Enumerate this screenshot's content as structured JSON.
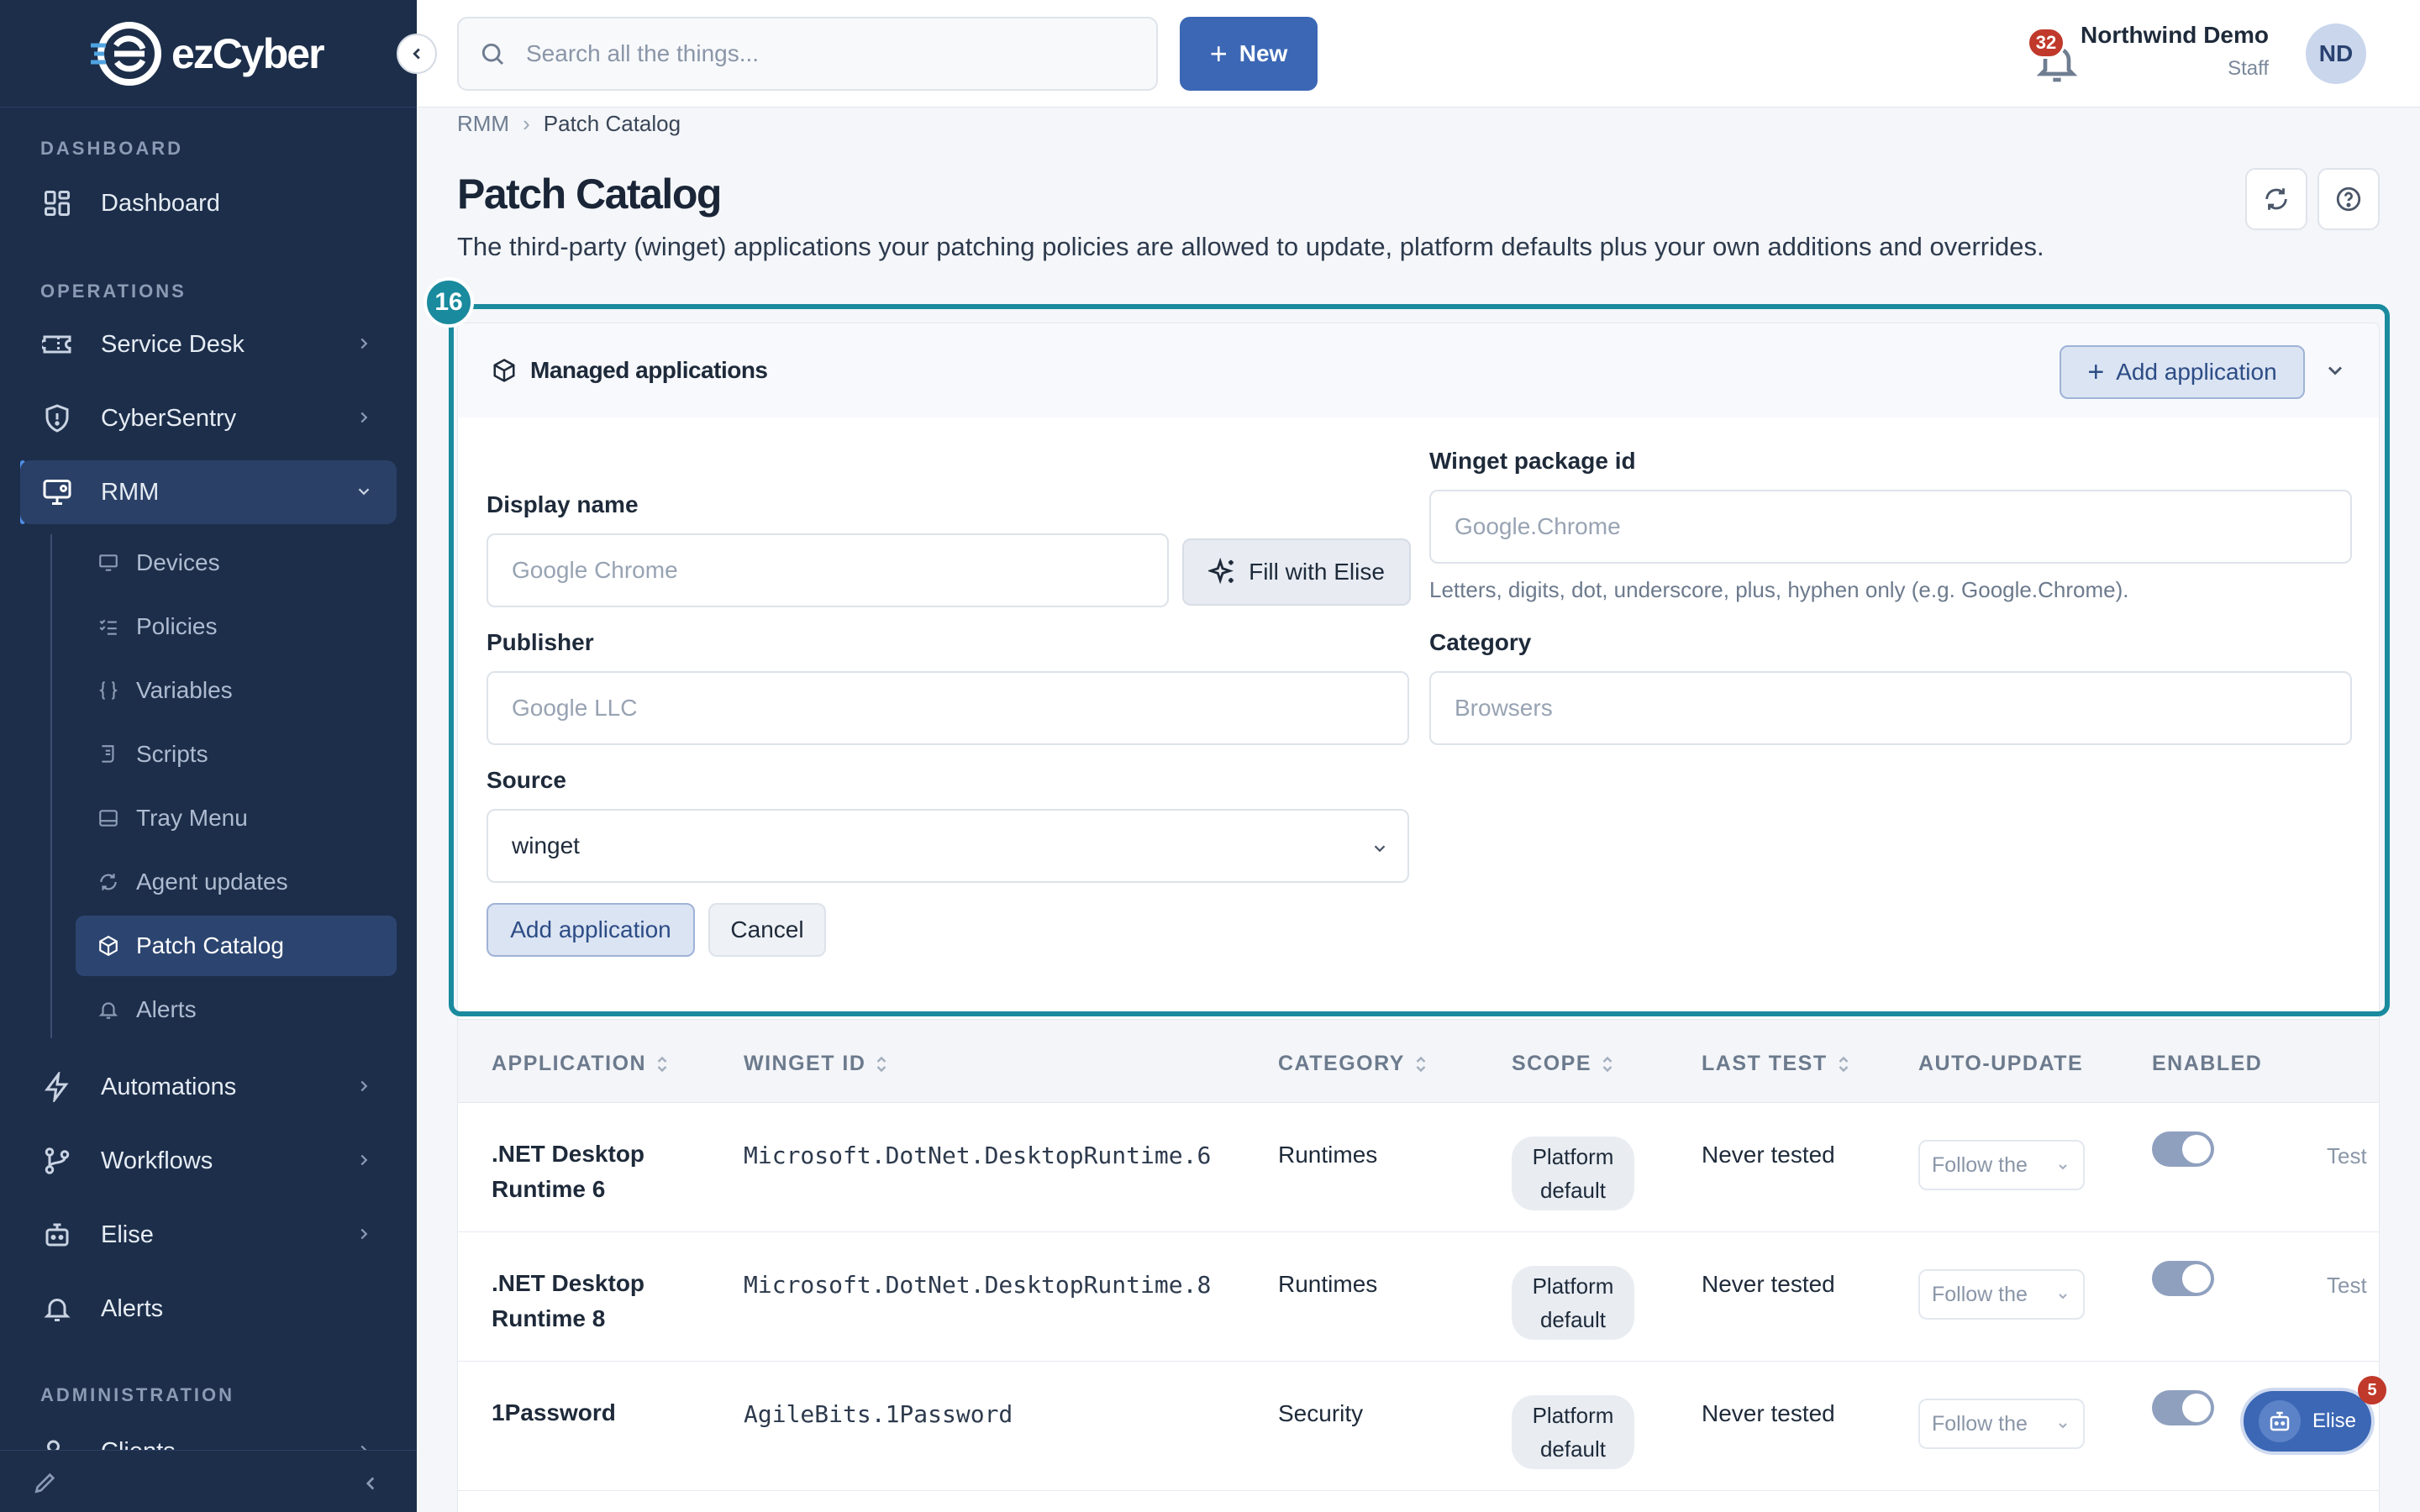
{
  "brand": {
    "logo_text": "ezCyber"
  },
  "sidebar": {
    "sections": {
      "dashboard": "DASHBOARD",
      "operations": "OPERATIONS",
      "administration": "ADMINISTRATION"
    },
    "items": {
      "dashboard": "Dashboard",
      "service_desk": "Service Desk",
      "cybersentry": "CyberSentry",
      "rmm": "RMM",
      "automations": "Automations",
      "workflows": "Workflows",
      "elise": "Elise",
      "alerts": "Alerts",
      "clients": "Clients"
    },
    "rmm_subitems": {
      "devices": "Devices",
      "policies": "Policies",
      "variables": "Variables",
      "scripts": "Scripts",
      "tray_menu": "Tray Menu",
      "agent_updates": "Agent updates",
      "patch_catalog": "Patch Catalog",
      "alerts": "Alerts"
    },
    "active_subitem": "Patch Catalog"
  },
  "topbar": {
    "search_placeholder": "Search all the things...",
    "new_label": "New",
    "notification_count": "32",
    "org_name": "Northwind Demo",
    "org_role": "Staff",
    "avatar_initials": "ND"
  },
  "breadcrumb": {
    "root": "RMM",
    "current": "Patch Catalog"
  },
  "page": {
    "title": "Patch Catalog",
    "description": "The third-party (winget) applications your patching policies are allowed to update, platform defaults plus your own additions and overrides."
  },
  "highlight_badge": "16",
  "card": {
    "title": "Managed applications",
    "add_button": "Add application"
  },
  "form": {
    "display_name": {
      "label": "Display name",
      "placeholder": "Google Chrome"
    },
    "fill_with_elise": "Fill with Elise",
    "winget_id": {
      "label": "Winget package id",
      "placeholder": "Google.Chrome",
      "hint": "Letters, digits, dot, underscore, plus, hyphen only (e.g. Google.Chrome)."
    },
    "publisher": {
      "label": "Publisher",
      "placeholder": "Google LLC"
    },
    "category": {
      "label": "Category",
      "placeholder": "Browsers"
    },
    "source": {
      "label": "Source",
      "value": "winget"
    },
    "submit": "Add application",
    "cancel": "Cancel"
  },
  "table": {
    "columns": {
      "application": "APPLICATION",
      "winget_id": "WINGET ID",
      "category": "CATEGORY",
      "scope": "SCOPE",
      "last_test": "LAST TEST",
      "auto_update": "AUTO-UPDATE",
      "enabled": "ENABLED"
    },
    "rows": [
      {
        "name_line1": ".NET Desktop",
        "name_line2": "Runtime 6",
        "winget_id": "Microsoft.DotNet.DesktopRuntime.6",
        "category": "Runtimes",
        "scope_line1": "Platform",
        "scope_line2": "default",
        "last_test": "Never tested",
        "auto_update": "Follow the",
        "enabled": true,
        "action": "Test"
      },
      {
        "name_line1": ".NET Desktop",
        "name_line2": "Runtime 8",
        "winget_id": "Microsoft.DotNet.DesktopRuntime.8",
        "category": "Runtimes",
        "scope_line1": "Platform",
        "scope_line2": "default",
        "last_test": "Never tested",
        "auto_update": "Follow the",
        "enabled": true,
        "action": "Test"
      },
      {
        "name_line1": "1Password",
        "name_line2": "",
        "winget_id": "AgileBits.1Password",
        "category": "Security",
        "scope_line1": "Platform",
        "scope_line2": "default",
        "last_test": "Never tested",
        "auto_update": "Follow the",
        "enabled": true,
        "action": ""
      }
    ]
  },
  "elise_fab": {
    "label": "Elise",
    "badge": "5"
  },
  "colors": {
    "sidebar_bg": "#1c2e4a",
    "primary": "#3b67b5",
    "highlight": "#1a8a9e",
    "badge_red": "#c0392b"
  }
}
